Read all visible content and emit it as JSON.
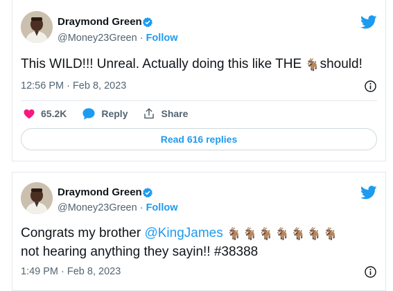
{
  "tweets": [
    {
      "author": {
        "name": "Draymond Green",
        "handle": "@Money23Green",
        "separator": "·",
        "follow_label": "Follow"
      },
      "text_before": "This WILD!!! Unreal. Actually doing this like THE ",
      "goat_emoji": "🐐",
      "text_after": "should!",
      "timestamp": "12:56 PM · Feb 8, 2023",
      "actions": {
        "likes_count": "65.2K",
        "reply_label": "Reply",
        "share_label": "Share"
      },
      "read_replies_label": "Read 616 replies"
    },
    {
      "author": {
        "name": "Draymond Green",
        "handle": "@Money23Green",
        "separator": "·",
        "follow_label": "Follow"
      },
      "text_before": "Congrats my brother ",
      "mention": "@KingJames",
      "goats": "🐐🐐🐐🐐🐐🐐🐐",
      "text_line2": "not hearing anything they sayin!! #38388",
      "timestamp": "1:49 PM · Feb 8, 2023"
    }
  ],
  "colors": {
    "accent": "#1d9bf0",
    "like": "#f91880",
    "muted": "#536471",
    "text": "#0f1419",
    "border": "#e3e8ec"
  },
  "icons": [
    "avatar",
    "verified-badge-icon",
    "twitter-bird-icon",
    "info-icon",
    "heart-icon",
    "reply-bubble-icon",
    "share-icon"
  ]
}
